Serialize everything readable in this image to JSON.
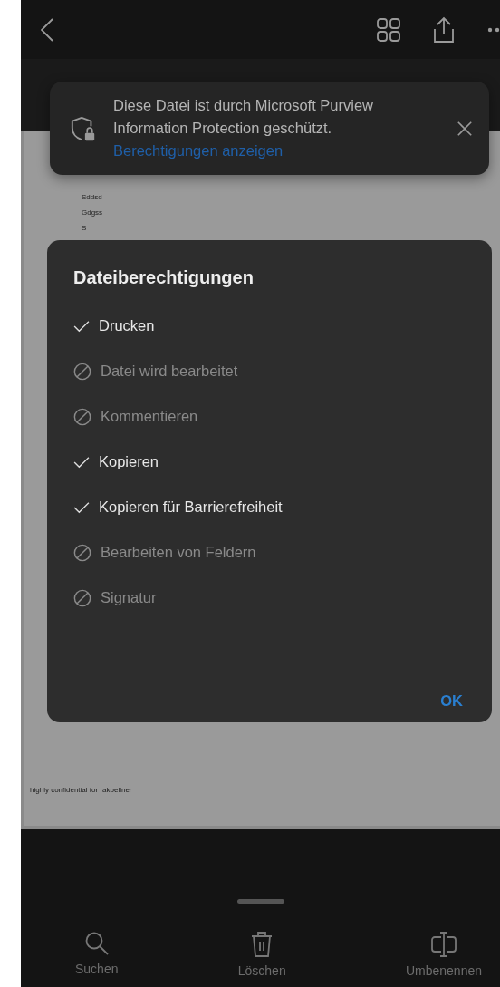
{
  "banner": {
    "message": "Diese Datei ist durch Microsoft Purview Information Protection geschützt.",
    "link": "Berechtigungen anzeigen"
  },
  "document": {
    "lines": [
      "Sddsd",
      "Gdgss",
      "S"
    ],
    "footer": "highly confidential for rakoellner"
  },
  "dialog": {
    "title": "Dateiberechtigungen",
    "permissions": [
      {
        "label": "Drucken",
        "allowed": true
      },
      {
        "label": "Datei wird bearbeitet",
        "allowed": false
      },
      {
        "label": "Kommentieren",
        "allowed": false
      },
      {
        "label": "Kopieren",
        "allowed": true
      },
      {
        "label": "Kopieren für Barrierefreiheit",
        "allowed": true
      },
      {
        "label": "Bearbeiten von Feldern",
        "allowed": false
      },
      {
        "label": "Signatur",
        "allowed": false
      }
    ],
    "ok": "OK"
  },
  "toolbar": [
    {
      "kind": "search",
      "label": "Suchen"
    },
    {
      "kind": "delete",
      "label": "Löschen"
    },
    {
      "kind": "rename",
      "label": "Umbenennen"
    }
  ]
}
